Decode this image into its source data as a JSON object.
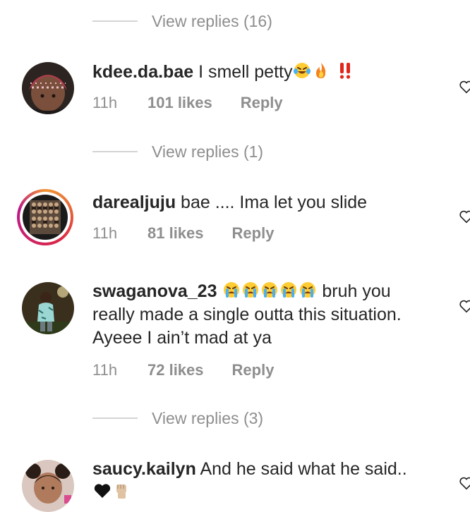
{
  "view_replies": [
    {
      "label": "View replies (16)"
    },
    {
      "label": "View replies (1)"
    },
    {
      "label": "View replies (3)"
    }
  ],
  "comments": [
    {
      "username": "kdee.da.bae",
      "text": "I smell petty",
      "emojis": [
        "laughing-tears-emoji",
        "fire-emoji",
        "double-exclamation-emoji"
      ],
      "time": "11h",
      "likes": "101 likes",
      "reply": "Reply"
    },
    {
      "username": "darealjuju",
      "text": "bae .... Ima let you slide",
      "time": "11h",
      "likes": "81 likes",
      "reply": "Reply"
    },
    {
      "username": "swaganova_23",
      "emojis_lead": [
        "crying-emoji",
        "crying-emoji",
        "crying-emoji",
        "crying-emoji",
        "crying-emoji"
      ],
      "text_line1": "bruh you",
      "text_line2": "really made a single outta this situation.",
      "text_line3": "Ayeee I ain’t mad at ya",
      "time": "11h",
      "likes": "72 likes",
      "reply": "Reply"
    },
    {
      "username": "saucy.kailyn",
      "text": "And he said what he said..",
      "emojis": [
        "black-heart-emoji",
        "raised-fist-emoji"
      ]
    }
  ],
  "colors": {
    "primary_text": "#262626",
    "secondary_text": "#8e8e8e",
    "divider": "#d4d4d4",
    "story_ring": "#dc2743"
  }
}
